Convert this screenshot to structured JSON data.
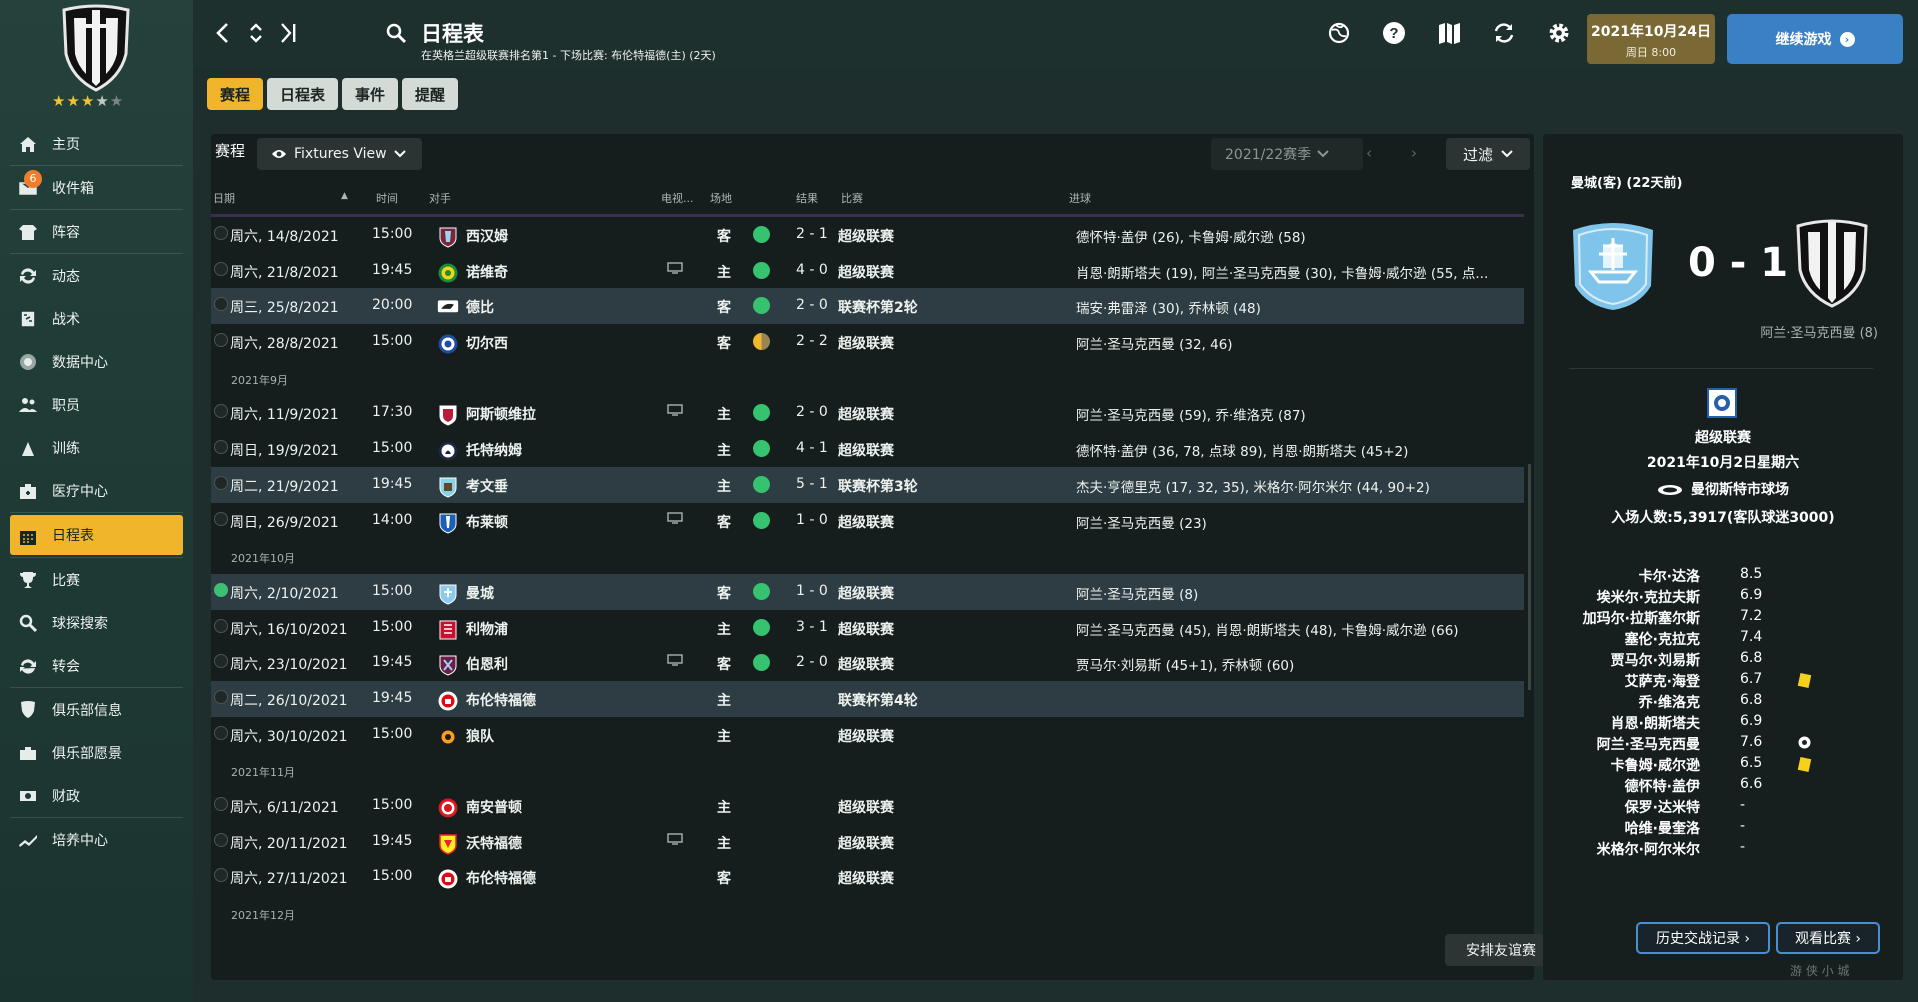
{
  "app": {
    "page_title": "日程表",
    "page_subtitle": "在英格兰超级联赛排名第1 - 下场比赛: 布伦特福德(主) (2天)",
    "date_main": "2021年10月24日",
    "date_sub": "周日 8:00",
    "continue_label": "继续游戏"
  },
  "sidebar": {
    "stars": "★★★",
    "half_star": "★",
    "empty_stars": "★",
    "items": [
      {
        "label": "主页",
        "icon": "home-icon"
      },
      {
        "label": "收件箱",
        "icon": "inbox-icon",
        "badge": "6"
      },
      {
        "label": "阵容",
        "icon": "squad-icon"
      },
      {
        "label": "动态",
        "icon": "dynamics-icon"
      },
      {
        "label": "战术",
        "icon": "tactics-icon"
      },
      {
        "label": "数据中心",
        "icon": "data-hub-icon"
      },
      {
        "label": "职员",
        "icon": "staff-icon"
      },
      {
        "label": "训练",
        "icon": "training-icon"
      },
      {
        "label": "医疗中心",
        "icon": "medical-icon"
      },
      {
        "label": "日程表",
        "icon": "calendar-icon"
      },
      {
        "label": "比赛",
        "icon": "trophy-icon"
      },
      {
        "label": "球探搜索",
        "icon": "scouting-icon"
      },
      {
        "label": "转会",
        "icon": "transfers-icon"
      },
      {
        "label": "俱乐部信息",
        "icon": "club-info-icon"
      },
      {
        "label": "俱乐部愿景",
        "icon": "club-vision-icon"
      },
      {
        "label": "财政",
        "icon": "finances-icon"
      },
      {
        "label": "培养中心",
        "icon": "development-icon"
      }
    ]
  },
  "tabs": [
    "赛程",
    "日程表",
    "事件",
    "提醒"
  ],
  "fixtures": {
    "panel_title": "赛程",
    "view_select": "Fixtures View",
    "season_select": "2021/22赛季",
    "filter_label": "过滤",
    "columns": {
      "date": "日期",
      "time": "时间",
      "opponent": "对手",
      "tv": "电视...",
      "venue": "场地",
      "result": "结果",
      "competition": "比赛",
      "goals": "进球"
    },
    "rows": [
      {
        "type": "match",
        "date": "周六, 14/8/2021",
        "time": "15:00",
        "team": "西汉姆",
        "crest": "westham",
        "tv": false,
        "venue": "客",
        "result": "win",
        "score": "2 - 1",
        "comp": "超级联赛",
        "goals": "德怀特·盖伊 (26), 卡鲁姆·威尔逊 (58)"
      },
      {
        "type": "match",
        "date": "周六, 21/8/2021",
        "time": "19:45",
        "team": "诺维奇",
        "crest": "norwich",
        "tv": true,
        "venue": "主",
        "result": "win",
        "score": "4 - 0",
        "comp": "超级联赛",
        "goals": "肖恩·朗斯塔夫 (19), 阿兰·圣马克西曼 (30), 卡鲁姆·威尔逊 (55, 点..."
      },
      {
        "type": "match",
        "date": "周三, 25/8/2021",
        "time": "20:00",
        "team": "德比",
        "crest": "derby",
        "tv": false,
        "venue": "客",
        "result": "win",
        "score": "2 - 0",
        "comp": "联赛杯第2轮",
        "goals": "瑞安·弗雷泽 (30), 乔林顿 (48)",
        "hl": true
      },
      {
        "type": "match",
        "date": "周六, 28/8/2021",
        "time": "15:00",
        "team": "切尔西",
        "crest": "chelsea",
        "tv": false,
        "venue": "客",
        "result": "draw",
        "score": "2 - 2",
        "comp": "超级联赛",
        "goals": "阿兰·圣马克西曼 (32, 46)"
      },
      {
        "type": "month",
        "label": "2021年9月"
      },
      {
        "type": "match",
        "date": "周六, 11/9/2021",
        "time": "17:30",
        "team": "阿斯顿维拉",
        "crest": "villa",
        "tv": true,
        "venue": "主",
        "result": "win",
        "score": "2 - 0",
        "comp": "超级联赛",
        "goals": "阿兰·圣马克西曼 (59), 乔·维洛克 (87)"
      },
      {
        "type": "match",
        "date": "周日, 19/9/2021",
        "time": "15:00",
        "team": "托特纳姆",
        "crest": "spurs",
        "tv": false,
        "venue": "主",
        "result": "win",
        "score": "4 - 1",
        "comp": "超级联赛",
        "goals": "德怀特·盖伊 (36, 78, 点球 89), 肖恩·朗斯塔夫 (45+2)"
      },
      {
        "type": "match",
        "date": "周二, 21/9/2021",
        "time": "19:45",
        "team": "考文垂",
        "crest": "coventry",
        "tv": false,
        "venue": "主",
        "result": "win",
        "score": "5 - 1",
        "comp": "联赛杯第3轮",
        "goals": "杰夫·亨德里克 (17, 32, 35), 米格尔·阿尔米尔 (44, 90+2)",
        "hl": true
      },
      {
        "type": "match",
        "date": "周日, 26/9/2021",
        "time": "14:00",
        "team": "布莱顿",
        "crest": "brighton",
        "tv": true,
        "venue": "客",
        "result": "win",
        "score": "1 - 0",
        "comp": "超级联赛",
        "goals": "阿兰·圣马克西曼 (23)"
      },
      {
        "type": "month",
        "label": "2021年10月"
      },
      {
        "type": "match",
        "date": "周六, 2/10/2021",
        "time": "15:00",
        "team": "曼城",
        "crest": "mancity",
        "tv": false,
        "venue": "客",
        "result": "win",
        "score": "1 - 0",
        "comp": "超级联赛",
        "goals": "阿兰·圣马克西曼 (8)",
        "hl": true,
        "checked": true
      },
      {
        "type": "match",
        "date": "周六, 16/10/2021",
        "time": "15:00",
        "team": "利物浦",
        "crest": "liverpool",
        "tv": false,
        "venue": "主",
        "result": "win",
        "score": "3 - 1",
        "comp": "超级联赛",
        "goals": "阿兰·圣马克西曼 (45), 肖恩·朗斯塔夫 (48), 卡鲁姆·威尔逊 (66)"
      },
      {
        "type": "match",
        "date": "周六, 23/10/2021",
        "time": "19:45",
        "team": "伯恩利",
        "crest": "burnley",
        "tv": true,
        "venue": "客",
        "result": "win",
        "score": "2 - 0",
        "comp": "超级联赛",
        "goals": "贾马尔·刘易斯 (45+1), 乔林顿 (60)"
      },
      {
        "type": "match",
        "date": "周二, 26/10/2021",
        "time": "19:45",
        "team": "布伦特福德",
        "crest": "brentford",
        "tv": false,
        "venue": "主",
        "result": "",
        "score": "",
        "comp": "联赛杯第4轮",
        "goals": "",
        "hl": true
      },
      {
        "type": "match",
        "date": "周六, 30/10/2021",
        "time": "15:00",
        "team": "狼队",
        "crest": "wolves",
        "tv": false,
        "venue": "主",
        "result": "",
        "score": "",
        "comp": "超级联赛",
        "goals": ""
      },
      {
        "type": "month",
        "label": "2021年11月"
      },
      {
        "type": "match",
        "date": "周六, 6/11/2021",
        "time": "15:00",
        "team": "南安普顿",
        "crest": "southampton",
        "tv": false,
        "venue": "主",
        "result": "",
        "score": "",
        "comp": "超级联赛",
        "goals": ""
      },
      {
        "type": "match",
        "date": "周六, 20/11/2021",
        "time": "19:45",
        "team": "沃特福德",
        "crest": "watford",
        "tv": true,
        "venue": "主",
        "result": "",
        "score": "",
        "comp": "超级联赛",
        "goals": ""
      },
      {
        "type": "match",
        "date": "周六, 27/11/2021",
        "time": "15:00",
        "team": "布伦特福德",
        "crest": "brentford",
        "tv": false,
        "venue": "客",
        "result": "",
        "score": "",
        "comp": "超级联赛",
        "goals": ""
      },
      {
        "type": "month",
        "label": "2021年12月"
      }
    ],
    "friendly_btn": "安排友谊赛"
  },
  "match_panel": {
    "title": "曼城(客) (22天前)",
    "score": "0 - 1",
    "scorer": "阿兰·圣马克西曼 (8)",
    "league": "超级联赛",
    "date": "2021年10月2日星期六",
    "stadium": "曼彻斯特市球场",
    "attendance": "入场人数:5,3917(客队球迷3000)",
    "ratings": [
      {
        "name": "卡尔·达洛",
        "val": "8.5",
        "icon": ""
      },
      {
        "name": "埃米尔·克拉夫斯",
        "val": "6.9",
        "icon": ""
      },
      {
        "name": "加玛尔·拉斯塞尔斯",
        "val": "7.2",
        "icon": ""
      },
      {
        "name": "塞伦·克拉克",
        "val": "7.4",
        "icon": ""
      },
      {
        "name": "贾马尔·刘易斯",
        "val": "6.8",
        "icon": ""
      },
      {
        "name": "艾萨克·海登",
        "val": "6.7",
        "icon": "yellow"
      },
      {
        "name": "乔·维洛克",
        "val": "6.8",
        "icon": ""
      },
      {
        "name": "肖恩·朗斯塔夫",
        "val": "6.9",
        "icon": ""
      },
      {
        "name": "阿兰·圣马克西曼",
        "val": "7.6",
        "icon": "ball"
      },
      {
        "name": "卡鲁姆·威尔逊",
        "val": "6.5",
        "icon": "yellow"
      },
      {
        "name": "德怀特·盖伊",
        "val": "6.6",
        "icon": ""
      },
      {
        "name": "保罗·达米特",
        "val": "-",
        "icon": ""
      },
      {
        "name": "哈维·曼奎洛",
        "val": "-",
        "icon": ""
      },
      {
        "name": "米格尔·阿尔米尔",
        "val": "-",
        "icon": ""
      }
    ],
    "h2h_btn": "历史交战记录 ›",
    "watch_btn": "观看比赛 ›"
  },
  "watermark": "游 侠 小 城"
}
